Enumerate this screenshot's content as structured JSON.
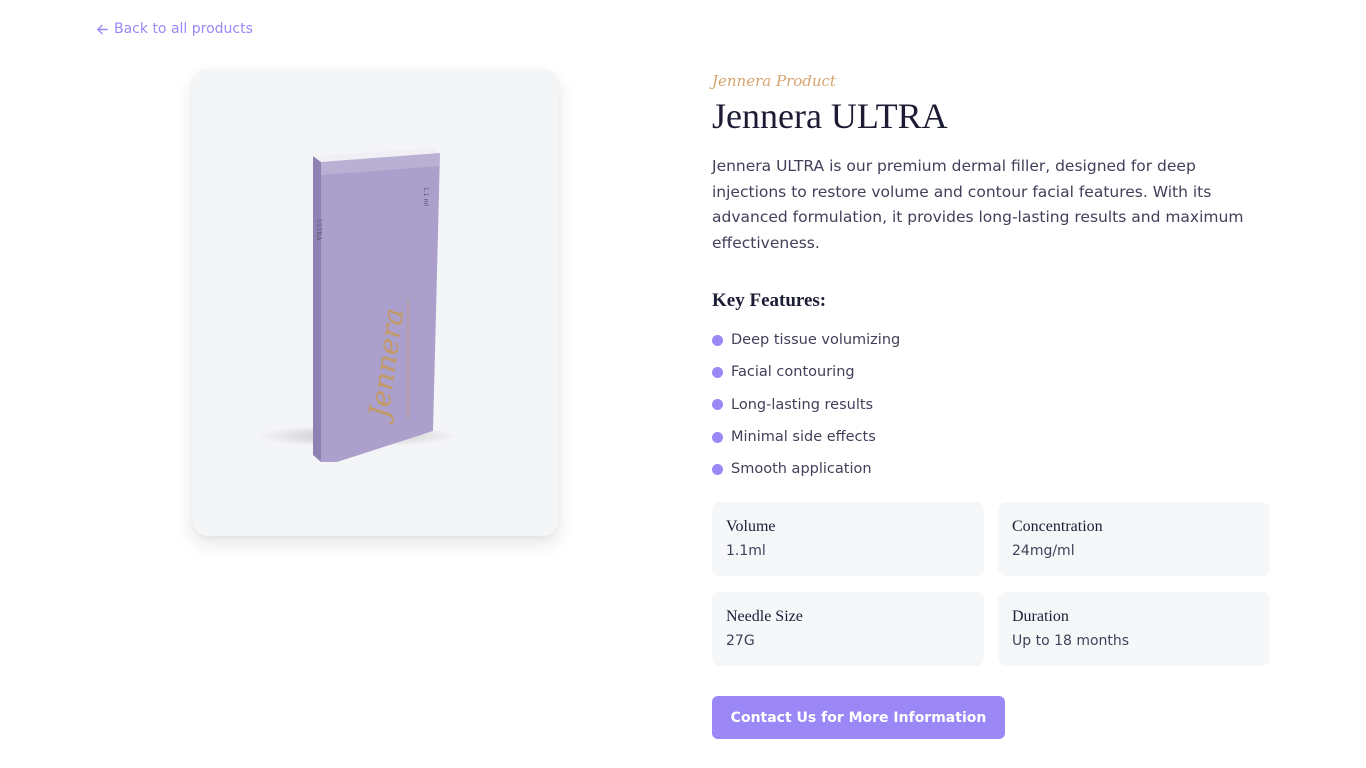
{
  "nav": {
    "back_label": "Back to all products",
    "back_icon": "arrow-left-icon"
  },
  "product": {
    "eyebrow": "Jennera Product",
    "title": "Jennera ULTRA",
    "description": "Jennera ULTRA is our premium dermal filler, designed for deep injections to restore volume and contour facial features. With its advanced formulation, it provides long-lasting results and maximum effectiveness.",
    "image_label": "Jennera",
    "box_side_text": "ULTRA",
    "box_volume_text": "1.1 ml"
  },
  "features": {
    "heading": "Key Features:",
    "items": [
      "Deep tissue volumizing",
      "Facial contouring",
      "Long-lasting results",
      "Minimal side effects",
      "Smooth application"
    ]
  },
  "specs": [
    {
      "label": "Volume",
      "value": "1.1ml"
    },
    {
      "label": "Concentration",
      "value": "24mg/ml"
    },
    {
      "label": "Needle Size",
      "value": "27G"
    },
    {
      "label": "Duration",
      "value": "Up to 18 months"
    }
  ],
  "cta": {
    "label": "Contact Us for More Information"
  },
  "colors": {
    "accent": "#9b87f5",
    "eyebrow": "#d6a36f",
    "heading": "#1c1c35",
    "box_front": "#ab9fcb",
    "box_side": "#8f82b3"
  }
}
